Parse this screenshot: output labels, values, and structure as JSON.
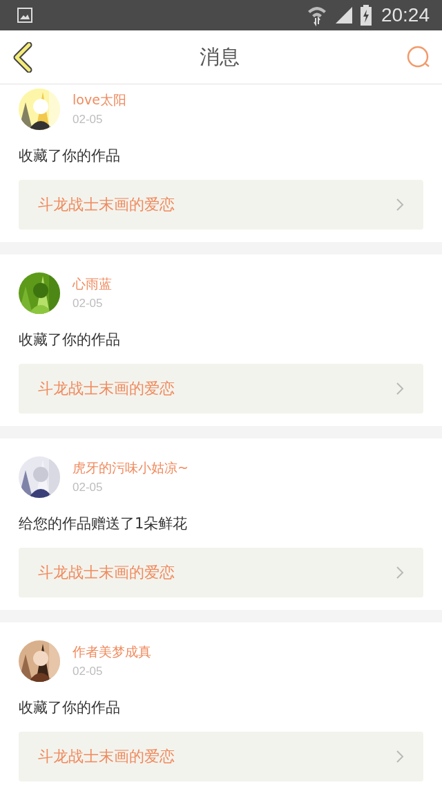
{
  "status_bar": {
    "time": "20:24"
  },
  "header": {
    "title": "消息"
  },
  "messages": [
    {
      "name": "love太阳",
      "date": "02-05",
      "text": "收藏了你的作品",
      "work": "斗龙战士末画的爱恋"
    },
    {
      "name": "心雨蓝",
      "date": "02-05",
      "text": "收藏了你的作品",
      "work": "斗龙战士末画的爱恋"
    },
    {
      "name": "虎牙的污味小姑凉~",
      "date": "02-05",
      "text": "给您的作品赠送了1朵鲜花",
      "work": "斗龙战士末画的爱恋"
    },
    {
      "name": "作者美梦成真",
      "date": "02-05",
      "text": "收藏了你的作品",
      "work": "斗龙战士末画的爱恋"
    }
  ]
}
